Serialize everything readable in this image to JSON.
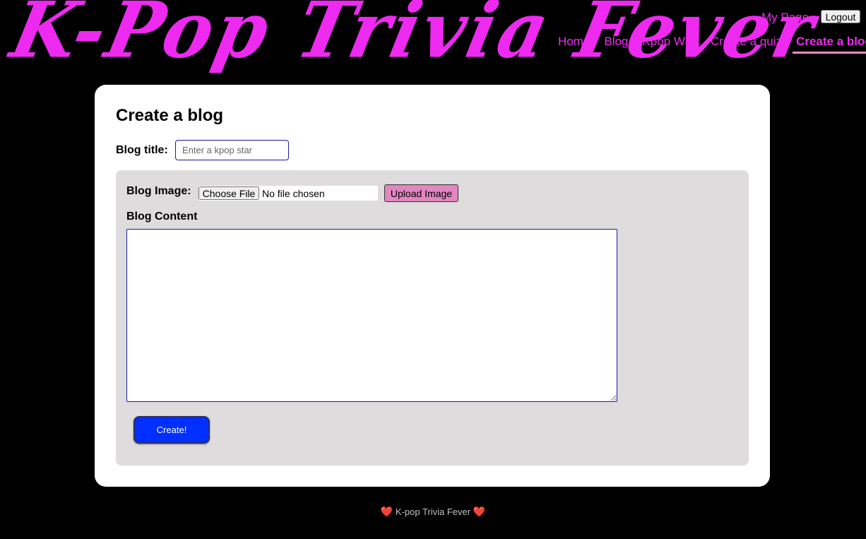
{
  "header": {
    "logo_text": "K-Pop Trivia Fever",
    "my_page_label": "My Page",
    "logout_label": "Logout",
    "nav": [
      {
        "label": "Home"
      },
      {
        "label": "Blog"
      },
      {
        "label": "Kpop Wiki"
      },
      {
        "label": "Create a quiz"
      },
      {
        "label": "Create a blog",
        "active": true
      }
    ]
  },
  "form": {
    "heading": "Create a blog",
    "title_label": "Blog title:",
    "title_placeholder": "Enter a kpop star",
    "title_value": "",
    "image_label": "Blog Image:",
    "choose_file_label": "Choose File",
    "file_status": "No file chosen",
    "upload_label": "Upload Image",
    "content_label": "Blog Content",
    "content_value": "",
    "submit_label": "Create!"
  },
  "footer": {
    "heart_left": "❤️",
    "text": "K-pop Trivia Fever",
    "heart_right": "❤️"
  },
  "colors": {
    "accent": "#ee2af0",
    "active_underline": "#f489c4",
    "upload_button": "#e286c0",
    "create_button": "#0030ff",
    "panel_background": "#dedcdd"
  }
}
